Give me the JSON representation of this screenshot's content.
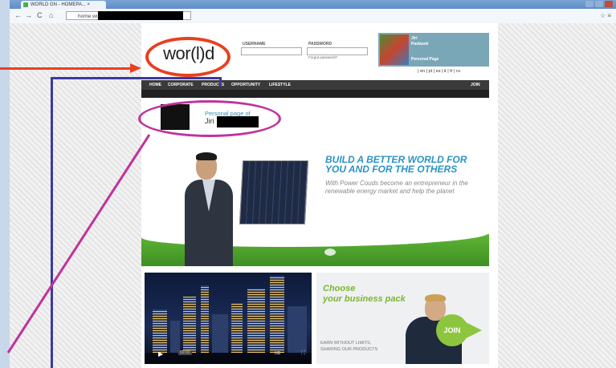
{
  "browser": {
    "tab_title": "WORLD GN - HOMEPA... ×",
    "nav_back": "←",
    "nav_forward": "→",
    "nav_reload": "C",
    "nav_home": "⌂",
    "url": "home.world",
    "toolbar_right": "☆ ≡"
  },
  "site": {
    "logo": "wor(l)d",
    "login": {
      "username_label": "USERNAME",
      "password_label": "PASSWORD",
      "forgot": "Forgot password?"
    },
    "profile_card": {
      "name_line1": "Jiri",
      "name_line2": "Pavlasek",
      "link": "Personal Page"
    },
    "languages": "| en | pt | es | it | fr | ru",
    "menu": [
      "HOME",
      "CORPORATE",
      "PRODUCTS",
      "OPPORTUNITY",
      "LIFESTYLE"
    ],
    "menu_join": "JOIN",
    "personal_page": {
      "label": "Personal page of",
      "name": "Jiri"
    },
    "banner": {
      "title_line1": "BUILD A BETTER WORLD FOR",
      "title_line2": "YOU AND FOR THE OTHERS",
      "subtitle": "With Power Couds become an entrepreneur in the renewable energy market and help the planet"
    },
    "video": {
      "play": "▶",
      "time": "00:00",
      "hd": "HD",
      "fullscreen": "⛶"
    },
    "business": {
      "title_line1": "Choose",
      "title_line2": "your business pack",
      "subtitle_line1": "EARN WITHOUT LIMITS,",
      "subtitle_line2": "SHARING OUR PRODUCTS",
      "join": "JOIN"
    }
  },
  "colors": {
    "annotation_red": "#e8401f",
    "annotation_blue": "#3b3aa0",
    "annotation_magenta": "#c0339c",
    "accent_blue": "#2a93c4",
    "accent_green": "#7cb532"
  }
}
